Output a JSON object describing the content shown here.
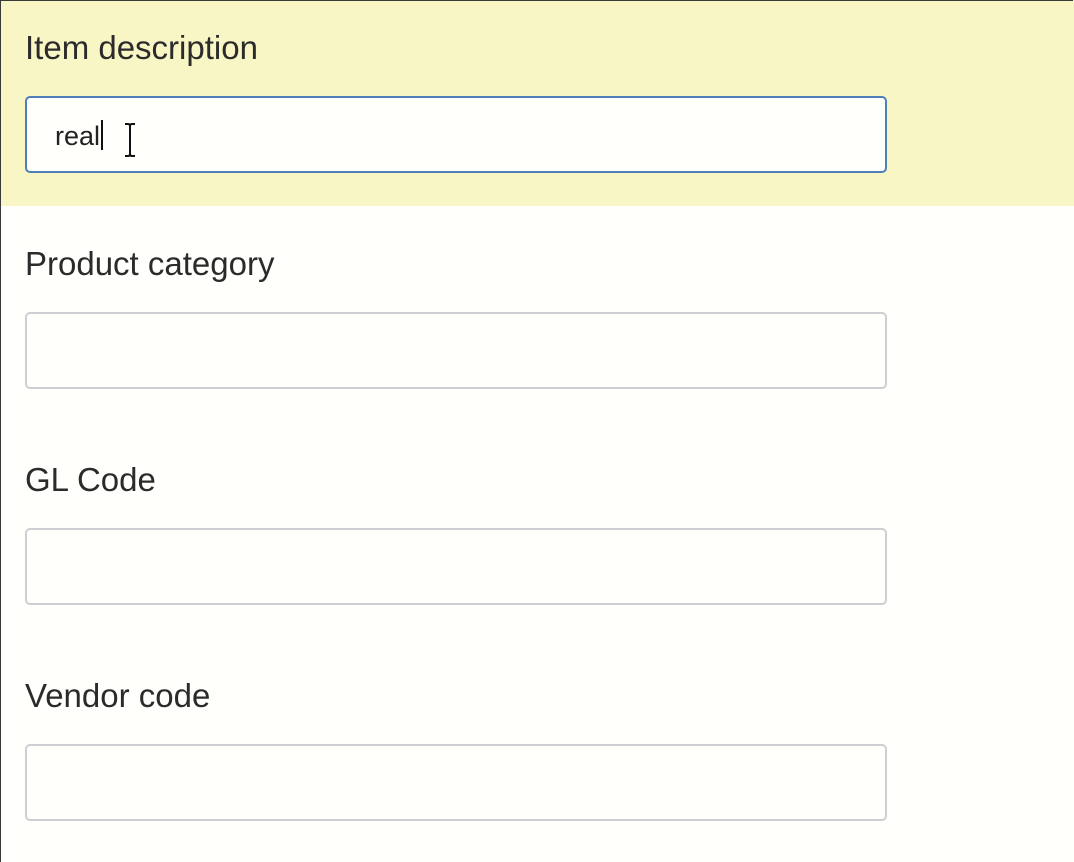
{
  "form": {
    "fields": [
      {
        "label": "Item description",
        "value": "real",
        "focused": true
      },
      {
        "label": "Product category",
        "value": ""
      },
      {
        "label": "GL Code",
        "value": ""
      },
      {
        "label": "Vendor code",
        "value": ""
      }
    ]
  },
  "colors": {
    "active_group_bg": "#f8f6c4",
    "focus_border": "#4f7fb8",
    "input_border": "#cfcfd3",
    "page_bg": "#fffffb"
  },
  "icons": {
    "cursor": "text-cursor-icon"
  }
}
